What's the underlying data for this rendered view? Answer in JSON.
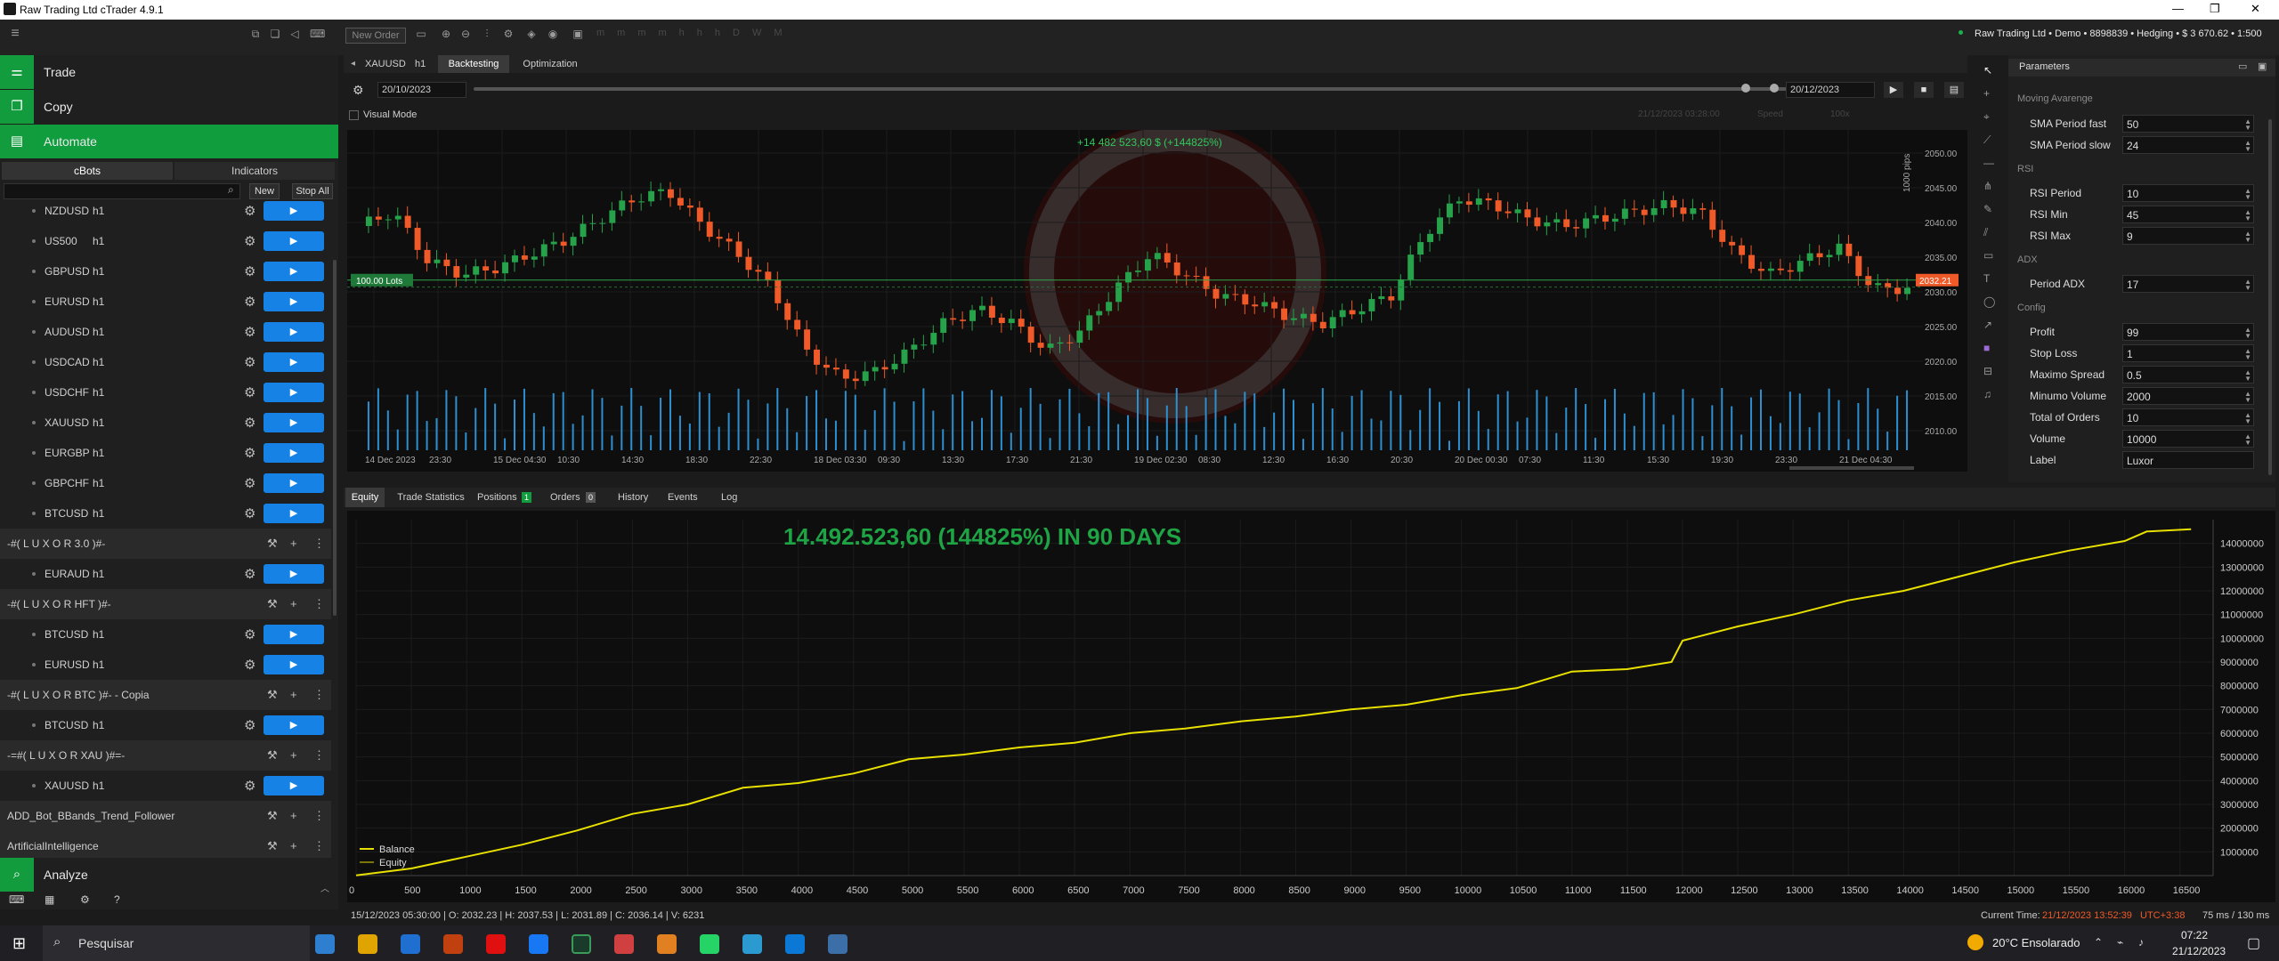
{
  "window": {
    "title": "Raw Trading Ltd cTrader 4.9.1"
  },
  "account": {
    "summary": "Raw Trading Ltd • Demo • 8898839 • Hedging • $ 3 670.62 • 1:500"
  },
  "toolbar": {
    "new_order": "New Order"
  },
  "nav": {
    "trade": "Trade",
    "copy": "Copy",
    "automate": "Automate",
    "analyze": "Analyze"
  },
  "subtabs": {
    "cbots": "cBots",
    "indicators": "Indicators"
  },
  "actions": {
    "new": "New",
    "stop_all": "Stop All",
    "search_placeholder": ""
  },
  "bots_top": [
    {
      "sym": "NZDUSD",
      "tf": "h1"
    },
    {
      "sym": "US500",
      "tf": "h1"
    },
    {
      "sym": "GBPUSD",
      "tf": "h1"
    },
    {
      "sym": "EURUSD",
      "tf": "h1"
    },
    {
      "sym": "AUDUSD",
      "tf": "h1"
    },
    {
      "sym": "USDCAD",
      "tf": "h1"
    },
    {
      "sym": "USDCHF",
      "tf": "h1"
    },
    {
      "sym": "XAUUSD",
      "tf": "h1"
    },
    {
      "sym": "EURGBP",
      "tf": "h1"
    },
    {
      "sym": "GBPCHF",
      "tf": "h1"
    },
    {
      "sym": "BTCUSD",
      "tf": "h1"
    }
  ],
  "groups": {
    "g1": "-#( L U X O R 3.0 )#-",
    "g1_rows": [
      {
        "sym": "EURAUD",
        "tf": "h1"
      }
    ],
    "g2": "-#( L U X O R HFT )#-",
    "g2_rows": [
      {
        "sym": "BTCUSD",
        "tf": "h1"
      },
      {
        "sym": "EURUSD",
        "tf": "h1"
      }
    ],
    "g3": "-#( L U X O R BTC )#- - Copia",
    "g3_rows": [
      {
        "sym": "BTCUSD",
        "tf": "h1"
      }
    ],
    "g4": "-=#( L U X O R XAU )#=-",
    "g4_rows": [
      {
        "sym": "XAUUSD",
        "tf": "h1"
      }
    ],
    "g5": "ADD_Bot_BBands_Trend_Follower",
    "g6": "ArtificialIntelligence"
  },
  "chart_tabs": {
    "symbol": "XAUUSD",
    "tf": "h1",
    "backtesting": "Backtesting",
    "optimization": "Optimization"
  },
  "backtest": {
    "start": "20/10/2023",
    "end": "20/12/2023",
    "visual_mode": "Visual Mode",
    "sim_time": "21/12/2023 03:28:00",
    "speed_label": "Speed",
    "speed": "100x"
  },
  "chart": {
    "profit_label": "+14 482 523,60 $ (+144825%)",
    "lots_label": "100.00 Lots",
    "price_tag": "2032.21",
    "y_ticks": [
      "2050.00",
      "2045.00",
      "2040.00",
      "2035.00",
      "2030.00",
      "2025.00",
      "2020.00",
      "2015.00",
      "2010.00"
    ],
    "x_ticks": [
      "14 Dec 2023",
      "23:30",
      "15 Dec 04:30",
      "10:30",
      "14:30",
      "18:30",
      "22:30",
      "18 Dec 03:30",
      "09:30",
      "13:30",
      "17:30",
      "21:30",
      "19 Dec 02:30",
      "08:30",
      "12:30",
      "16:30",
      "20:30",
      "20 Dec 00:30",
      "07:30",
      "11:30",
      "15:30",
      "19:30",
      "23:30",
      "21 Dec 04:30"
    ],
    "pips_label": "1000 pips",
    "colors": {
      "bull": "#26a34a",
      "bear": "#f05a28",
      "volume": "#2d8fd0"
    }
  },
  "bottom_tabs": {
    "equity": "Equity",
    "trade_stats": "Trade Statistics",
    "positions": "Positions",
    "positions_count": "1",
    "orders": "Orders",
    "orders_count": "0",
    "history": "History",
    "events": "Events",
    "log": "Log"
  },
  "equity": {
    "headline": "14.492.523,60 (144825%) IN 90 DAYS",
    "legend_balance": "Balance",
    "legend_equity": "Equity"
  },
  "chart_data": {
    "type": "line",
    "title": "",
    "xlabel": "",
    "ylabel": "",
    "xlim": [
      0,
      16800
    ],
    "ylim": [
      0,
      15000000
    ],
    "x_ticks": [
      0,
      500,
      1000,
      1500,
      2000,
      2500,
      3000,
      3500,
      4000,
      4500,
      5000,
      5500,
      6000,
      6500,
      7000,
      7500,
      8000,
      8500,
      9000,
      9500,
      10000,
      10500,
      11000,
      11500,
      12000,
      12500,
      13000,
      13500,
      14000,
      14500,
      15000,
      15500,
      16000,
      16500
    ],
    "y_ticks": [
      1000000,
      2000000,
      3000000,
      4000000,
      5000000,
      6000000,
      7000000,
      8000000,
      9000000,
      10000000,
      11000000,
      12000000,
      13000000,
      14000000
    ],
    "legend": "bottom-left",
    "series": [
      {
        "name": "Balance",
        "color": "#e8e000",
        "x": [
          0,
          500,
          1000,
          1500,
          2000,
          2500,
          3000,
          3500,
          4000,
          4500,
          5000,
          5500,
          6000,
          6500,
          7000,
          7500,
          8000,
          8500,
          9000,
          9500,
          10000,
          10500,
          11000,
          11500,
          11900,
          12000,
          12500,
          13000,
          13500,
          14000,
          14500,
          15000,
          15500,
          16000,
          16200,
          16600
        ],
        "y": [
          10000,
          300000,
          800000,
          1300000,
          1900000,
          2600000,
          3000000,
          3700000,
          3900000,
          4300000,
          4900000,
          5100000,
          5400000,
          5600000,
          6000000,
          6200000,
          6500000,
          6700000,
          7000000,
          7200000,
          7600000,
          7900000,
          8600000,
          8700000,
          9000000,
          9900000,
          10500000,
          11000000,
          11600000,
          12000000,
          12600000,
          13200000,
          13700000,
          14100000,
          14500000,
          14600000
        ]
      },
      {
        "name": "Equity",
        "color": "#e8e000",
        "x": [
          0,
          16600
        ],
        "y": [
          10000,
          14600000
        ]
      }
    ]
  },
  "params": {
    "title": "Parameters",
    "group_ma": "Moving Avarenge",
    "sma_fast_l": "SMA Period fast",
    "sma_fast_v": "50",
    "sma_slow_l": "SMA Period slow",
    "sma_slow_v": "24",
    "group_rsi": "RSI",
    "rsi_period_l": "RSI Period",
    "rsi_period_v": "10",
    "rsi_min_l": "RSI Min",
    "rsi_min_v": "45",
    "rsi_max_l": "RSI Max",
    "rsi_max_v": "9",
    "group_adx": "ADX",
    "adx_l": "Period ADX",
    "adx_v": "17",
    "group_cfg": "Config",
    "profit_l": "Profit",
    "profit_v": "99",
    "sl_l": "Stop Loss",
    "sl_v": "1",
    "spread_l": "Maximo Spread",
    "spread_v": "0.5",
    "minvol_l": "Minumo Volume",
    "minvol_v": "2000",
    "orders_l": "Total of Orders",
    "orders_v": "10",
    "vol_l": "Volume",
    "vol_v": "10000",
    "label_l": "Label",
    "label_v": "Luxor"
  },
  "status": {
    "ohlc": "15/12/2023 05:30:00 | O: 2032.23 | H: 2037.53 | L: 2031.89 | C: 2036.14 | V: 6231",
    "current_time_label": "Current Time:",
    "current_time": "21/12/2023 13:52:39",
    "utc": "UTC+3:38",
    "latency": "75 ms / 130 ms"
  },
  "taskbar": {
    "search": "Pesquisar",
    "weather": "20°C  Ensolarado",
    "time": "07:22",
    "date": "21/12/2023"
  }
}
